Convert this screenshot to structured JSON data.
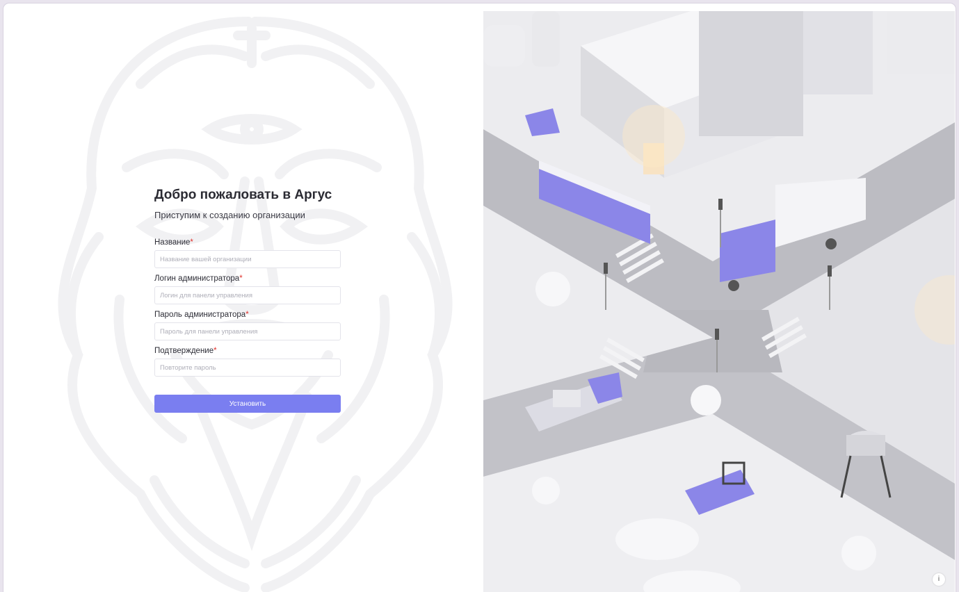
{
  "welcome": {
    "title": "Добро пожаловать в Аргус",
    "subtitle": "Приступим к созданию организации"
  },
  "form": {
    "required_mark": "*",
    "fields": [
      {
        "label": "Название",
        "placeholder": "Название вашей организации"
      },
      {
        "label": "Логин администратора",
        "placeholder": "Логин для панели управления"
      },
      {
        "label": "Пароль администратора",
        "placeholder": "Пароль для панели управления"
      },
      {
        "label": "Подтверждение",
        "placeholder": "Повторите пароль"
      }
    ],
    "submit_label": "Установить"
  },
  "info_button": {
    "label": "i",
    "icon": "info-icon"
  },
  "colors": {
    "accent": "#7a7ef0",
    "required": "#e0322c",
    "vehicle_purple": "#8b86e8"
  }
}
